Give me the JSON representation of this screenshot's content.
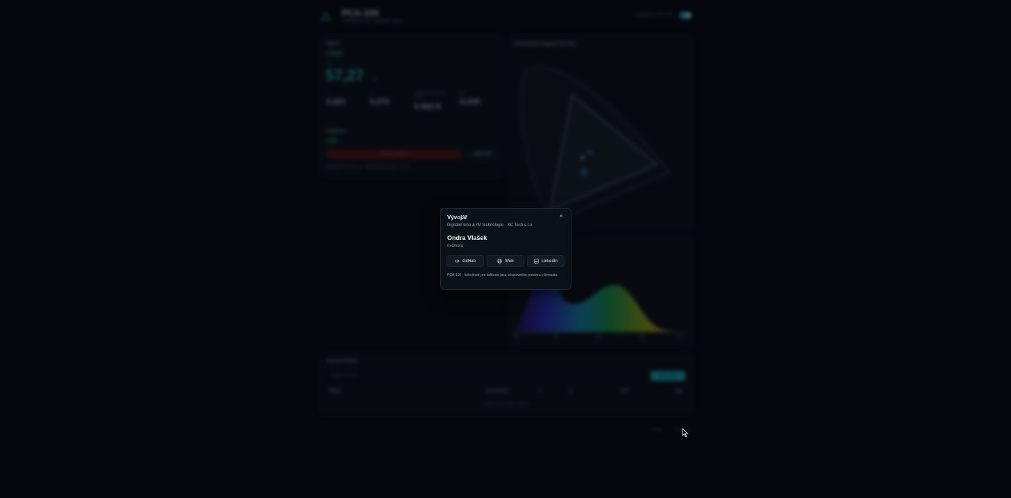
{
  "app": {
    "title": "PCA-100",
    "subtitle": "Kolorimetr pro kalibraci kina",
    "toggle_label": "Připojeno: PCA-100",
    "toggle_on": true,
    "accent": "#19b9c9"
  },
  "measurement": {
    "title": "Měření",
    "badge": "Stabilní",
    "main_label": "nits",
    "main_value": "57,27",
    "main_unit": "fL",
    "metrics": [
      {
        "label": "x",
        "value": "0,321"
      },
      {
        "label": "y",
        "value": "0,270"
      },
      {
        "label": "Korelovaná barevná teplota",
        "value": "6 522 K"
      },
      {
        "label": "Duv",
        "value": "-0,035"
      }
    ],
    "calibration_title": "Kalibrace",
    "calibration_badge": "Živě",
    "calibration_button": "Zastavit měření",
    "next_button": "Další bod",
    "footer": "Integrační čas: 100 ms · Vzorkovací frekvence: 10 Hz"
  },
  "chromaticity": {
    "title": "Chromatický diagram CIE 1931",
    "point_label": "D65"
  },
  "spectrum": {
    "ticks": [
      "380",
      "480",
      "580",
      "680",
      "780"
    ]
  },
  "history": {
    "title": "Historie měření",
    "search_placeholder": "Hledat v měřeních",
    "export_button": "Uložit měření",
    "columns": [
      "Název",
      "Jas (cd/m²)",
      "x",
      "y",
      "CCT",
      "Čas"
    ],
    "empty": "Zatím nebyla uložena měření"
  },
  "footer": {
    "left": "Vývojář",
    "right": "Nápověda"
  },
  "modal": {
    "title": "Vývojář",
    "subtitle": "Digitální kino & AV technologie · XC Tech s.r.o.",
    "name": "Ondra Vlašek",
    "handle": "0xOndra",
    "links": [
      {
        "label": "GitHub",
        "icon": "code-icon"
      },
      {
        "label": "Web",
        "icon": "globe-icon"
      },
      {
        "label": "LinkedIn",
        "icon": "linkedin-icon"
      }
    ],
    "note": "PCA-100 · kolorimetr pro kalibraci jasu a barevného prostoru v kinosálu.",
    "close": "×"
  }
}
